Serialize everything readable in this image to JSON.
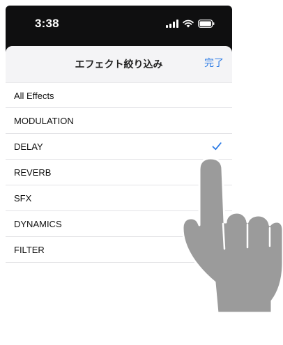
{
  "status_bar": {
    "time": "3:38",
    "icons": [
      "signal-icon",
      "wifi-icon",
      "battery-icon"
    ]
  },
  "sheet": {
    "title": "エフェクト絞り込み",
    "done_label": "完了",
    "items": [
      {
        "label": "All Effects",
        "selected": false
      },
      {
        "label": "MODULATION",
        "selected": false
      },
      {
        "label": "DELAY",
        "selected": true
      },
      {
        "label": "REVERB",
        "selected": false
      },
      {
        "label": "SFX",
        "selected": false
      },
      {
        "label": "DYNAMICS",
        "selected": false
      },
      {
        "label": "FILTER",
        "selected": false
      }
    ]
  },
  "colors": {
    "accent": "#2c7be5",
    "status_bar_bg": "#0f0f10",
    "header_bg": "#f4f4f6",
    "hand": "#9b9b9b"
  },
  "overlay": {
    "icon": "pointing-hand-icon"
  }
}
